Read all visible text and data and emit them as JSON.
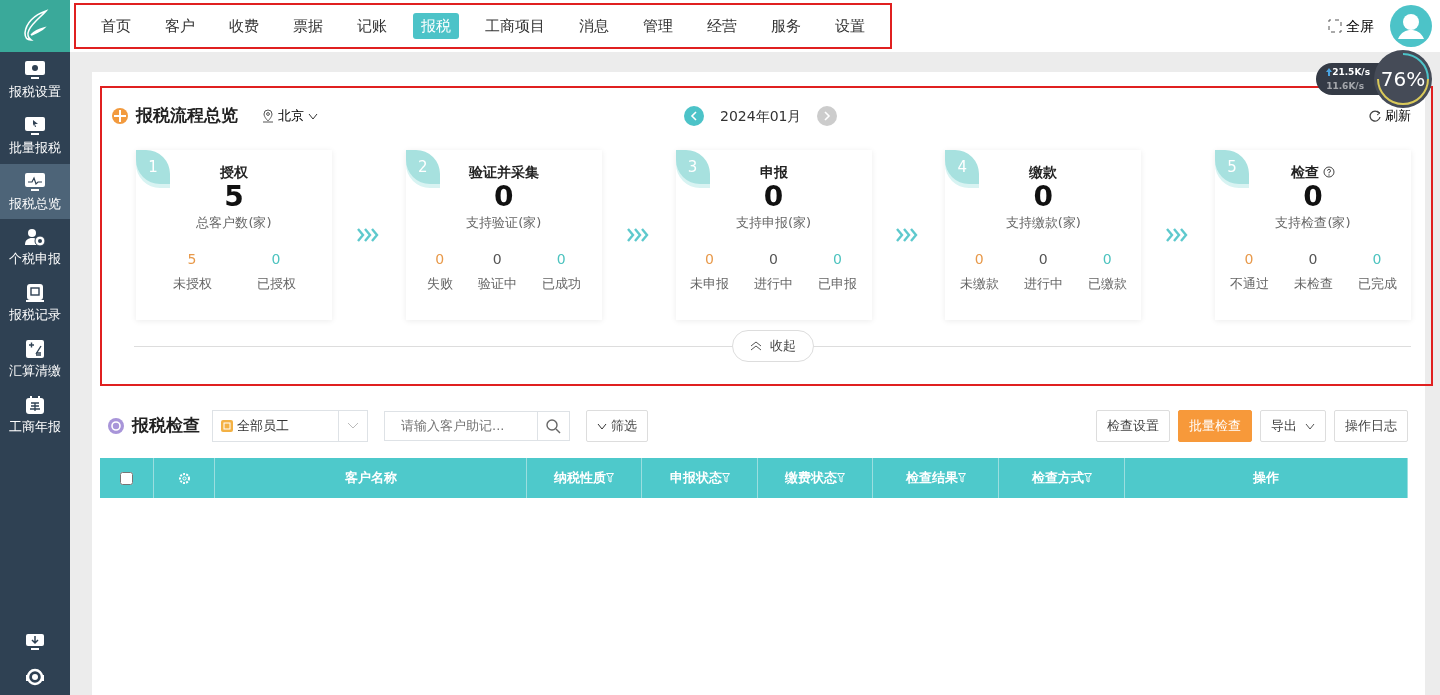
{
  "sidebar": {
    "items": [
      {
        "label": "报税设置",
        "selected": false
      },
      {
        "label": "批量报税",
        "selected": false
      },
      {
        "label": "报税总览",
        "selected": true
      },
      {
        "label": "个税申报",
        "selected": false
      },
      {
        "label": "报税记录",
        "selected": false
      },
      {
        "label": "汇算清缴",
        "selected": false
      },
      {
        "label": "工商年报",
        "selected": false
      }
    ]
  },
  "nav": {
    "tabs": [
      {
        "label": "首页",
        "selected": false
      },
      {
        "label": "客户",
        "selected": false
      },
      {
        "label": "收费",
        "selected": false
      },
      {
        "label": "票据",
        "selected": false
      },
      {
        "label": "记账",
        "selected": false
      },
      {
        "label": "报税",
        "selected": true
      },
      {
        "label": "工商项目",
        "selected": false
      },
      {
        "label": "消息",
        "selected": false
      },
      {
        "label": "管理",
        "selected": false
      },
      {
        "label": "经营",
        "selected": false
      },
      {
        "label": "服务",
        "selected": false
      },
      {
        "label": "设置",
        "selected": false
      }
    ],
    "fullscreen": "全屏"
  },
  "speed_widget": {
    "upload": "21.5K/s",
    "download": "11.6K/s",
    "percent": "76%"
  },
  "overview": {
    "title": "报税流程总览",
    "region": "北京",
    "period": "2024年01月",
    "refresh": "刷新",
    "collapse": "收起",
    "steps": [
      {
        "number": "1",
        "title": "授权",
        "help": false,
        "total": "5",
        "total_label": "总客户数(家)",
        "stats": [
          {
            "value": "5",
            "label": "未授权",
            "color": "#e8994a"
          },
          {
            "value": "0",
            "label": "已授权",
            "color": "#4cc3bf"
          }
        ]
      },
      {
        "number": "2",
        "title": "验证并采集",
        "help": false,
        "total": "0",
        "total_label": "支持验证(家)",
        "stats": [
          {
            "value": "0",
            "label": "失败",
            "color": "#e8994a"
          },
          {
            "value": "0",
            "label": "验证中",
            "color": "#555555"
          },
          {
            "value": "0",
            "label": "已成功",
            "color": "#4cc3bf"
          }
        ]
      },
      {
        "number": "3",
        "title": "申报",
        "help": false,
        "total": "0",
        "total_label": "支持申报(家)",
        "stats": [
          {
            "value": "0",
            "label": "未申报",
            "color": "#e8994a"
          },
          {
            "value": "0",
            "label": "进行中",
            "color": "#555555"
          },
          {
            "value": "0",
            "label": "已申报",
            "color": "#4cc3bf"
          }
        ]
      },
      {
        "number": "4",
        "title": "缴款",
        "help": false,
        "total": "0",
        "total_label": "支持缴款(家)",
        "stats": [
          {
            "value": "0",
            "label": "未缴款",
            "color": "#e8994a"
          },
          {
            "value": "0",
            "label": "进行中",
            "color": "#555555"
          },
          {
            "value": "0",
            "label": "已缴款",
            "color": "#4cc3bf"
          }
        ]
      },
      {
        "number": "5",
        "title": "检查",
        "help": true,
        "total": "0",
        "total_label": "支持检查(家)",
        "stats": [
          {
            "value": "0",
            "label": "不通过",
            "color": "#e8994a"
          },
          {
            "value": "0",
            "label": "未检查",
            "color": "#555555"
          },
          {
            "value": "0",
            "label": "已完成",
            "color": "#4cc3bf"
          }
        ]
      }
    ]
  },
  "check": {
    "title": "报税检查",
    "staff_select": "全部员工",
    "search": {
      "placeholder": "请输入客户助记..."
    },
    "filter": "筛选",
    "buttons": [
      {
        "label": "检查设置",
        "kind": "default"
      },
      {
        "label": "批量检查",
        "kind": "primary"
      },
      {
        "label": "导出",
        "kind": "dropdown"
      },
      {
        "label": "操作日志",
        "kind": "default"
      }
    ],
    "table": {
      "select_all": {
        "checked": false
      },
      "columns": [
        {
          "label": "客户名称",
          "filter": false
        },
        {
          "label": "纳税性质",
          "filter": true
        },
        {
          "label": "申报状态",
          "filter": true
        },
        {
          "label": "缴费状态",
          "filter": true
        },
        {
          "label": "检查结果",
          "filter": true
        },
        {
          "label": "检查方式",
          "filter": true
        },
        {
          "label": "操作",
          "filter": false
        }
      ]
    }
  }
}
